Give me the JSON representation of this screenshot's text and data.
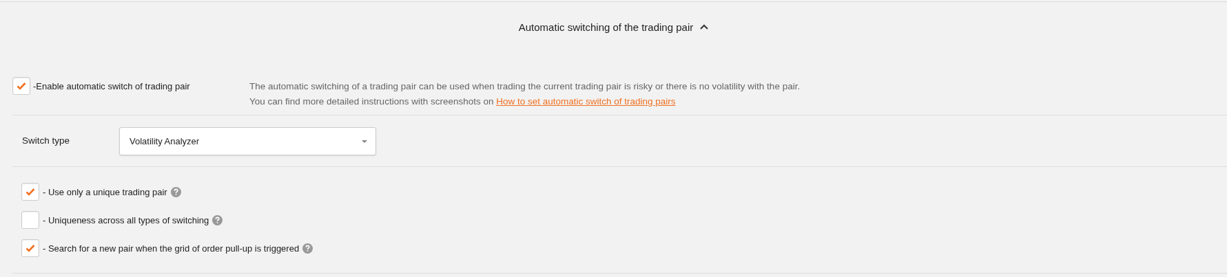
{
  "section": {
    "title": "Automatic switching of the trading pair",
    "expanded": true
  },
  "enable": {
    "label": "-Enable automatic switch of trading pair",
    "checked": true
  },
  "description": {
    "line_1": "The automatic switching of a trading pair can be used when trading the current trading pair is risky or there is no volatility with the pair.",
    "line_2": "You can find more detailed instructions with screenshots on ",
    "link": "How to set automatic switch of trading pairs"
  },
  "switch_type": {
    "label": "Switch type",
    "value": "Volatility Analyzer"
  },
  "options": [
    {
      "label": "- Use only a unique trading pair",
      "checked": true
    },
    {
      "label": "- Uniqueness across all types of switching",
      "checked": false
    },
    {
      "label": "- Search for a new pair when the grid of order pull-up is triggered",
      "checked": true
    }
  ]
}
